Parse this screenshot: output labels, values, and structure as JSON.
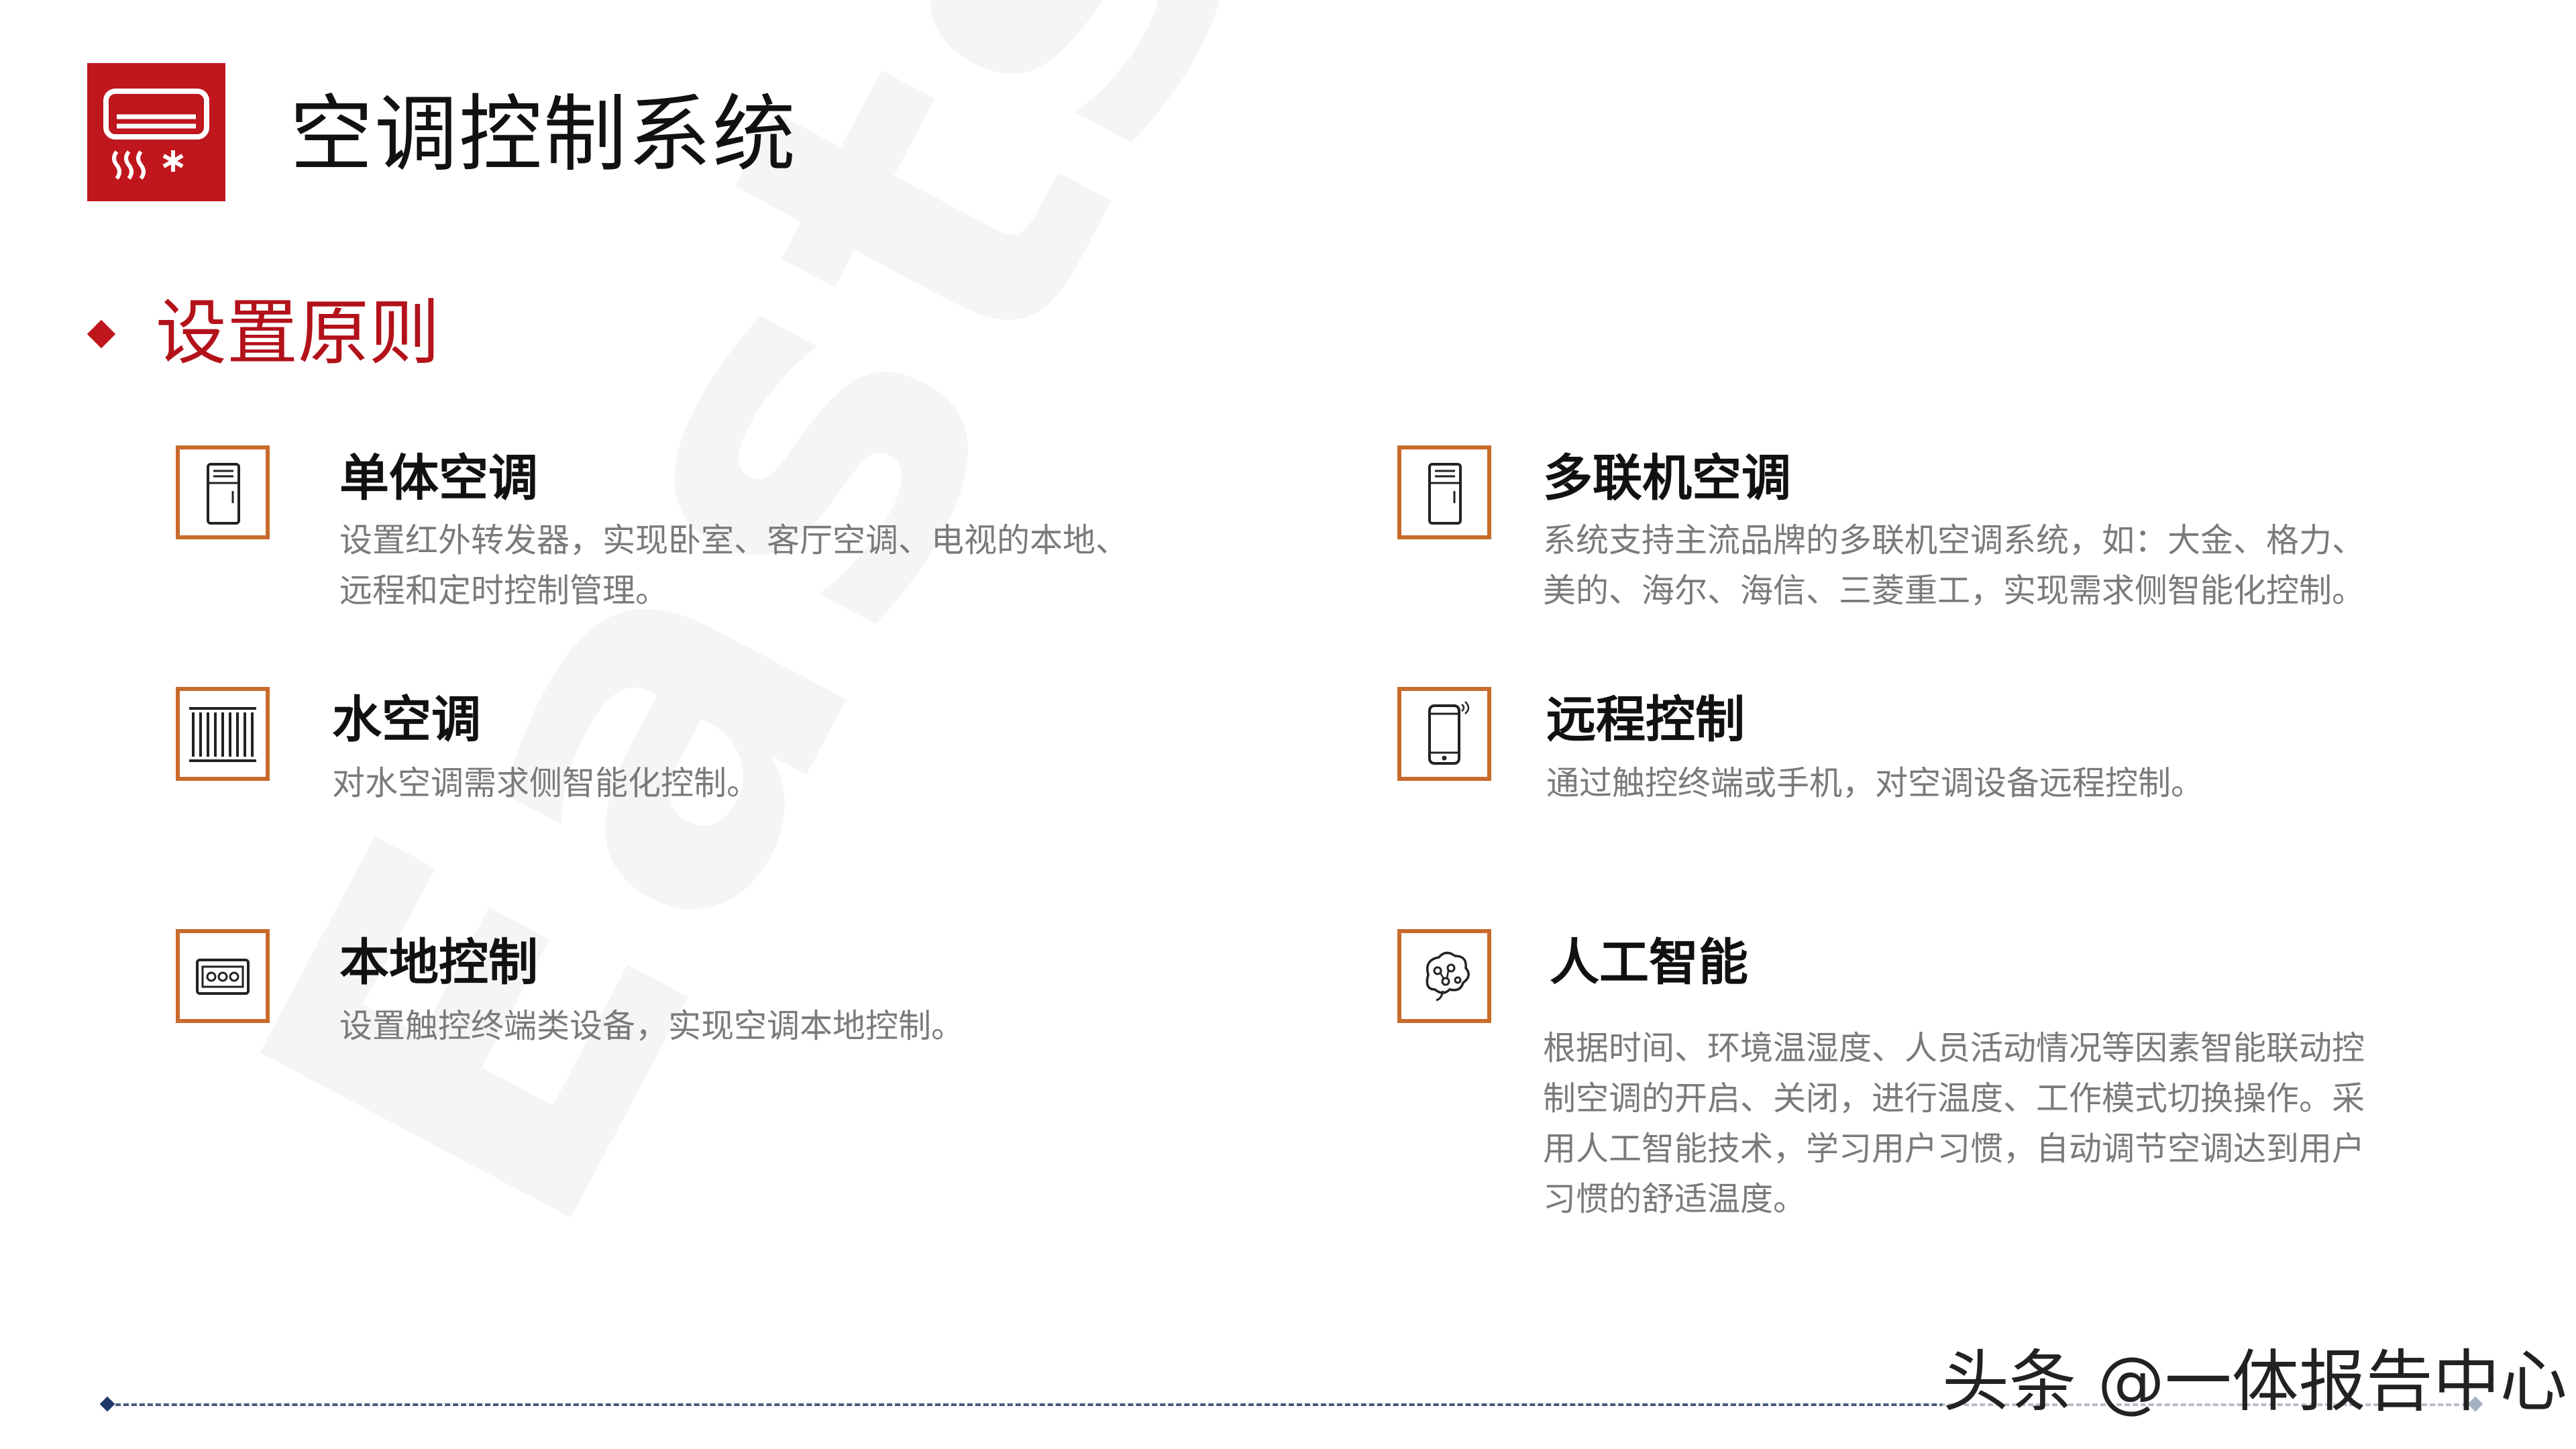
{
  "watermark": "Eastsoft",
  "header": {
    "title": "空调控制系统",
    "logo_icon": "air-conditioner-icon"
  },
  "section": {
    "heading": "设置原则"
  },
  "items": [
    {
      "icon": "single-ac-unit-icon",
      "title": "单体空调",
      "desc": "设置红外转发器，实现卧室、客厅空调、电视的本地、远程和定时控制管理。"
    },
    {
      "icon": "multi-split-ac-unit-icon",
      "title": "多联机空调",
      "desc": "系统支持主流品牌的多联机空调系统，如：大金、格力、美的、海尔、海信、三菱重工，实现需求侧智能化控制。"
    },
    {
      "icon": "radiator-icon",
      "title": "水空调",
      "desc": "对水空调需求侧智能化控制。"
    },
    {
      "icon": "mobile-phone-icon",
      "title": "远程控制",
      "desc": "通过触控终端或手机，对空调设备远程控制。"
    },
    {
      "icon": "control-panel-icon",
      "title": "本地控制",
      "desc": "设置触控终端类设备，实现空调本地控制。"
    },
    {
      "icon": "brain-icon",
      "title": "人工智能",
      "desc": "根据时间、环境温湿度、人员活动情况等因素智能联动控制空调的开启、关闭，进行温度、工作模式切换操作。采用人工智能技术，学习用户习惯，自动调节空调达到用户习惯的舒适温度。"
    }
  ],
  "footer": {
    "text": "头条 @一体报告中心"
  },
  "colors": {
    "brand_red": "#c0161d",
    "heading_red": "#b3121a",
    "icon_border": "#c96b2c",
    "desc_gray": "#7a7a7a"
  }
}
